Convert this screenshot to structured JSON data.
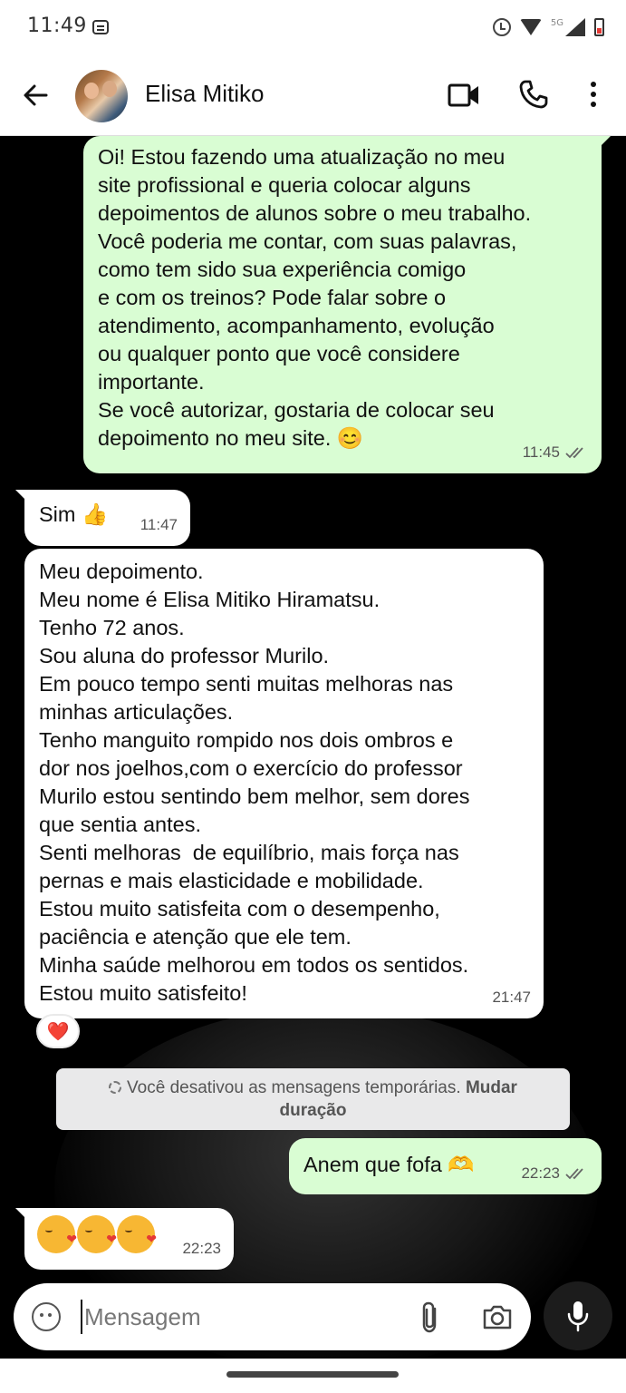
{
  "status_bar": {
    "time": "11:49",
    "network": "5G"
  },
  "header": {
    "contact_name": "Elisa Mitiko"
  },
  "messages": [
    {
      "direction": "outgoing",
      "text": "Oi! Estou fazendo uma atualização no meu\nsite profissional e queria colocar alguns\ndepoimentos de alunos sobre o meu trabalho.\nVocê poderia me contar, com suas palavras,\ncomo tem sido sua experiência comigo\ne com os treinos? Pode falar sobre o\natendimento, acompanhamento, evolução\nou qualquer ponto que você considere\nimportante.\nSe você autorizar, gostaria de colocar seu\ndepoimento no meu site. 😊",
      "time": "11:45"
    },
    {
      "direction": "incoming",
      "text": "Sim 👍",
      "time": "11:47"
    },
    {
      "direction": "incoming",
      "text": "Meu depoimento.\nMeu nome é Elisa Mitiko Hiramatsu.\nTenho 72 anos.\nSou aluna do professor Murilo.\nEm pouco tempo senti muitas melhoras nas\nminhas articulações.\nTenho manguito rompido nos dois ombros e\ndor nos joelhos,com o exercício do professor\nMurilo estou sentindo bem melhor, sem dores\nque sentia antes.\nSenti melhoras  de equilíbrio, mais força nas\npernas e mais elasticidade e mobilidade.\nEstou muito satisfeita com o desempenho,\npaciência e atenção que ele tem.\nMinha saúde melhorou em todos os sentidos.\nEstou muito satisfeito!",
      "time": "21:47",
      "reaction": "❤️"
    },
    {
      "direction": "system",
      "text": "Você desativou as mensagens temporárias.",
      "link": "Mudar duração"
    },
    {
      "direction": "outgoing",
      "text": "Anem que fofa 🫶",
      "time": "22:23"
    },
    {
      "direction": "incoming",
      "emoji_count": 3,
      "emoji_name": "face-blowing-kiss",
      "time": "22:23"
    }
  ],
  "composer": {
    "placeholder": "Mensagem"
  },
  "colors": {
    "outgoing_bubble": "#d9fdd3",
    "incoming_bubble": "#ffffff",
    "chat_background": "#000000"
  }
}
